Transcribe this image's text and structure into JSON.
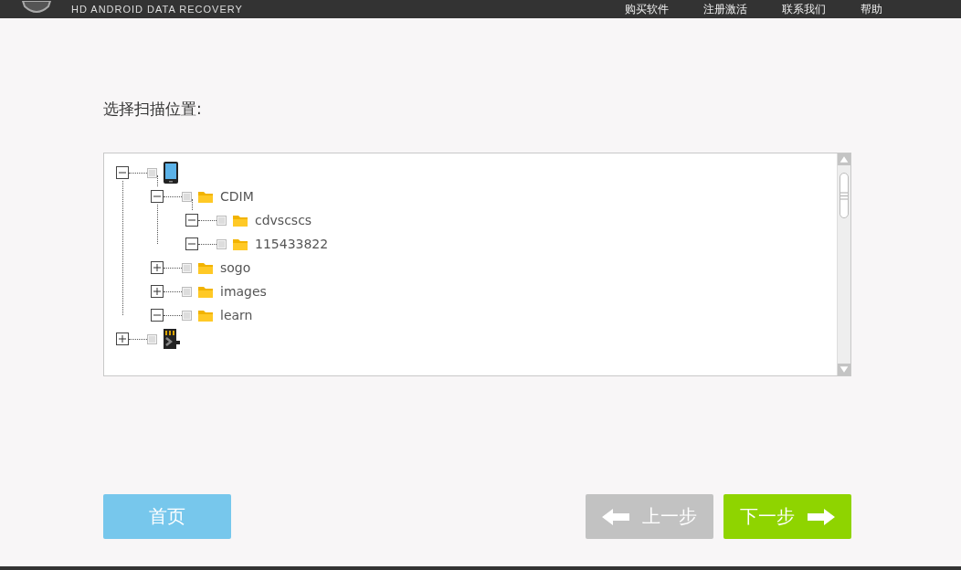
{
  "header": {
    "app_title": "HD ANDROID DATA RECOVERY",
    "nav": [
      "购买软件",
      "注册激活",
      "联系我们",
      "帮助"
    ]
  },
  "prompt": "选择扫描位置:",
  "tree": [
    {
      "kind": "phone",
      "expanded": true,
      "checked": false,
      "children": [
        {
          "kind": "folder",
          "label": "CDIM",
          "expanded": true,
          "checked": false,
          "children": [
            {
              "kind": "folder",
              "label": "cdvscscs",
              "expanded": true,
              "checked": false
            },
            {
              "kind": "folder",
              "label": "115433822",
              "expanded": true,
              "checked": false
            }
          ]
        },
        {
          "kind": "folder",
          "label": "sogo",
          "expanded": false,
          "checked": false
        },
        {
          "kind": "folder",
          "label": "images",
          "expanded": false,
          "checked": false
        },
        {
          "kind": "folder",
          "label": "learn",
          "expanded": true,
          "checked": false
        }
      ]
    },
    {
      "kind": "sdcard",
      "expanded": false,
      "checked": false
    }
  ],
  "buttons": {
    "home": "首页",
    "back": "上一步",
    "next": "下一步"
  }
}
